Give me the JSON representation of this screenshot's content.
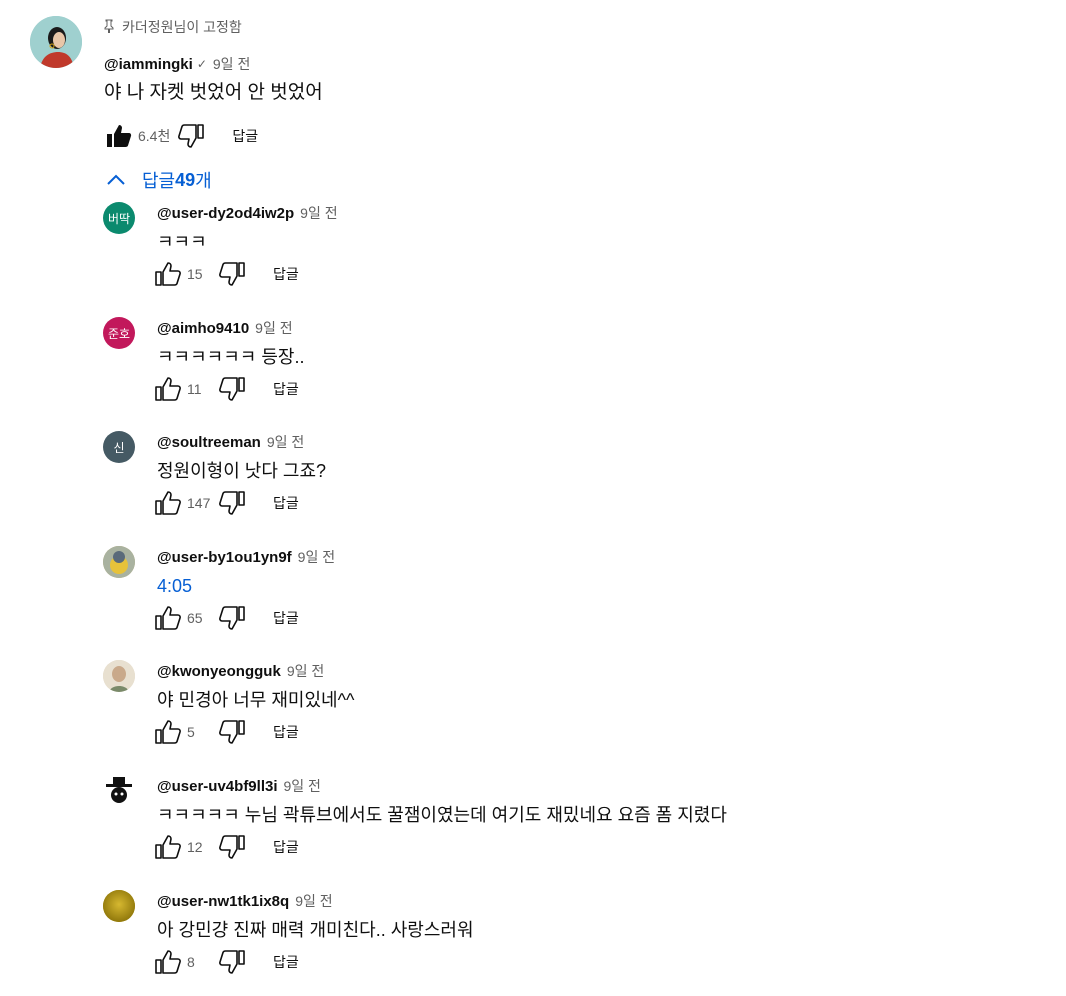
{
  "pinned_comment": {
    "pinned_label": "카더정원님이 고정함",
    "author": "@iammingki",
    "verified_mark": "✓",
    "time": "9일 전",
    "text": "야 나 자켓 벗었어 안 벗었어",
    "likes": "6.4천",
    "liked": true,
    "reply_label": "답글",
    "avatar_bg": "#9fd0cf"
  },
  "replies_toggle": {
    "prefix": "답글 ",
    "count": "49",
    "suffix": "개",
    "expanded": true,
    "color": "#065fd4"
  },
  "reply_label": "답글",
  "replies": [
    {
      "avatar_text": "버딱",
      "avatar_bg": "#0b8a6e",
      "author": "@user-dy2od4iw2p",
      "time": "9일 전",
      "text": "ㅋㅋㅋ",
      "likes": "15"
    },
    {
      "avatar_text": "준호",
      "avatar_bg": "#c2185b",
      "author": "@aimho9410",
      "time": "9일 전",
      "text": "ㅋㅋㅋㅋㅋㅋ 등장..",
      "likes": "11"
    },
    {
      "avatar_text": "신",
      "avatar_bg": "#455a64",
      "author": "@soultreeman",
      "time": "9일 전",
      "text": "정원이형이 낫다 그죠?",
      "likes": "147"
    },
    {
      "avatar_text": "",
      "avatar_bg": "#c9b26a",
      "author": "@user-by1ou1yn9f",
      "time": "9일 전",
      "text": "4:05",
      "is_link": true,
      "likes": "65"
    },
    {
      "avatar_text": "",
      "avatar_bg": "#e3d6c3",
      "author": "@kwonyeongguk",
      "time": "9일 전",
      "text": "야 민경아 너무 재미있네^^",
      "likes": "5"
    },
    {
      "avatar_text": "",
      "avatar_bg": "#ffffff",
      "author": "@user-uv4bf9ll3i",
      "time": "9일 전",
      "text": "ㅋㅋㅋㅋㅋ 누님  곽튜브에서도 꿀잼이였는데 여기도 재밌네요 요즘 폼 지렸다",
      "likes": "12"
    },
    {
      "avatar_text": "",
      "avatar_bg": "#b59a10",
      "author": "@user-nw1tk1ix8q",
      "time": "9일 전",
      "text": "아 강민걍 진짜 매력 개미친다.. 사랑스러워",
      "likes": "8"
    }
  ]
}
